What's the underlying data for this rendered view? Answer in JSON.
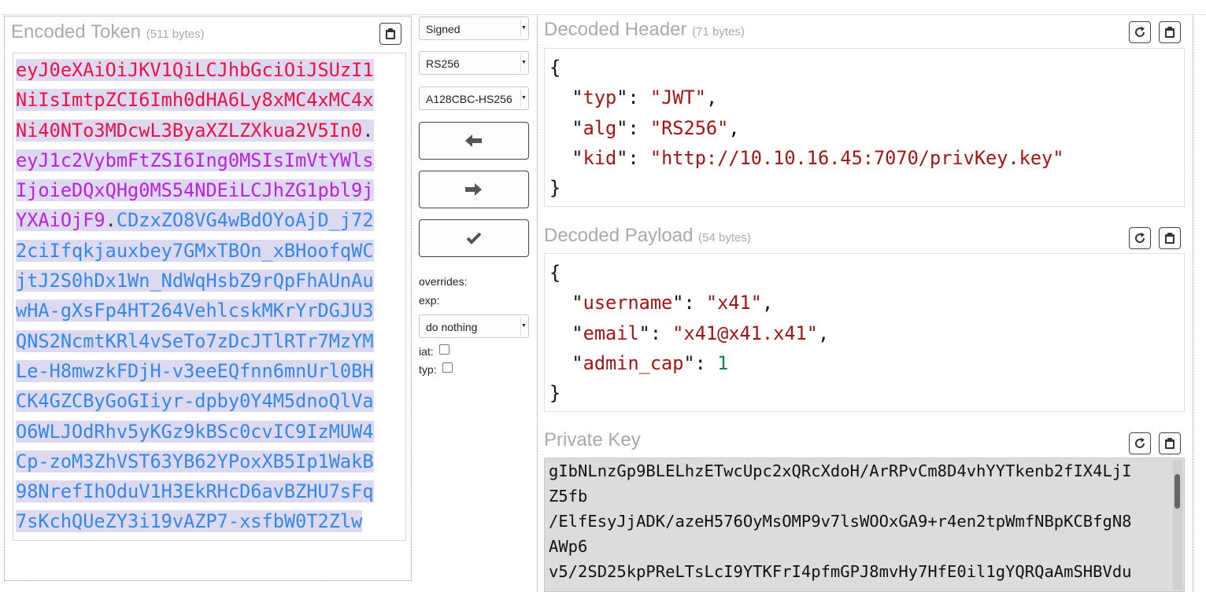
{
  "encoded": {
    "title": "Encoded Token",
    "bytes": "(511 bytes)",
    "token_lines": [
      [
        {
          "t": "h",
          "v": "eyJ0eXAiOiJKV1QiLCJhbGciOiJSUzI1"
        }
      ],
      [
        {
          "t": "h",
          "v": "NiIsImtpZCI6Imh0dHA6Ly8xMC4xMC4x"
        }
      ],
      [
        {
          "t": "h",
          "v": "Ni40NTo3MDcwL3ByaXZLZXkua2V5In0"
        },
        {
          "t": "d",
          "v": "."
        }
      ],
      [
        {
          "t": "p",
          "v": "eyJ1c2VybmFtZSI6Ing0MSIsImVtYWls"
        }
      ],
      [
        {
          "t": "p",
          "v": "IjoieDQxQHg0MS54NDEiLCJhZG1pbl9j"
        }
      ],
      [
        {
          "t": "p",
          "v": "YXAiOjF9"
        },
        {
          "t": "d",
          "v": "."
        },
        {
          "t": "s",
          "v": "CDzxZO8VG4wBdOYoAjD_j72"
        }
      ],
      [
        {
          "t": "s",
          "v": "2ciIfqkjauxbey7GMxTBOn_xBHoofqWC"
        }
      ],
      [
        {
          "t": "s",
          "v": "jtJ2S0hDx1Wn_NdWqHsbZ9rQpFhAUnAu"
        }
      ],
      [
        {
          "t": "s",
          "v": "wHA-gXsFp4HT264VehlcskMKrYrDGJU3"
        }
      ],
      [
        {
          "t": "s",
          "v": "QNS2NcmtKRl4vSeTo7zDcJTlRTr7MzYM"
        }
      ],
      [
        {
          "t": "s",
          "v": "Le-H8mwzkFDjH-v3eeEQfnn6mnUrl0BH"
        }
      ],
      [
        {
          "t": "s",
          "v": "CK4GZCByGoGIiyr-dpby0Y4M5dnoQlVa"
        }
      ],
      [
        {
          "t": "s",
          "v": "O6WLJOdRhv5yKGz9kBSc0cvIC9IzMUW4"
        }
      ],
      [
        {
          "t": "s",
          "v": "Cp-zoM3ZhVST63YB62YPoxXB5Ip1WakB"
        }
      ],
      [
        {
          "t": "s",
          "v": "98NrefIhOduV1H3EkRHcD6avBZHU7sFq"
        }
      ],
      [
        {
          "t": "s",
          "v": "7sKchQUeZY3i19vAZP7-xsfbW0T2Zlw"
        }
      ]
    ]
  },
  "controls": {
    "mode_select": "Signed",
    "alg_select": "RS256",
    "enc_select": "A128CBC-HS256",
    "overrides_label": "overrides:",
    "exp_label": "exp:",
    "exp_select": "do nothing",
    "iat_label": "iat:",
    "typ_label": "typ:",
    "iat_checked": false,
    "typ_checked": false
  },
  "header": {
    "title": "Decoded Header",
    "bytes": "(71 bytes)",
    "fields": [
      {
        "key": "typ",
        "value": "JWT",
        "kind": "string"
      },
      {
        "key": "alg",
        "value": "RS256",
        "kind": "string"
      },
      {
        "key": "kid",
        "value": "http://10.10.16.45:7070/privKey.key",
        "kind": "string"
      }
    ]
  },
  "payload": {
    "title": "Decoded Payload",
    "bytes": "(54 bytes)",
    "fields": [
      {
        "key": "username",
        "value": "x41",
        "kind": "string"
      },
      {
        "key": "email",
        "value": "x41@x41.x41",
        "kind": "string"
      },
      {
        "key": "admin_cap",
        "value": "1",
        "kind": "number"
      }
    ]
  },
  "private_key": {
    "title": "Private Key",
    "lines": [
      "gIbNLnzGp9BLELhzETwcUpc2xQRcXdoH/ArRPvCm8D4vhYYTkenb2fIX4LjI",
      "Z5fb",
      "/ElfEsyJjADK/azeH576OyMsOMP9v7lsWOOxGA9+r4en2tpWmfNBpKCBfgN8",
      "AWp6",
      "v5/2SD25kpPReLTsLcI9YTKFrI4pfmGPJ8mvHy7HfE0il1gYQRQaAmSHBVdu"
    ]
  },
  "icons": {
    "copy": "clipboard-icon",
    "regenerate": "refresh-icon",
    "decode_left": "arrow-left-icon",
    "encode_right": "arrow-right-icon",
    "verify": "checkmark-icon"
  }
}
